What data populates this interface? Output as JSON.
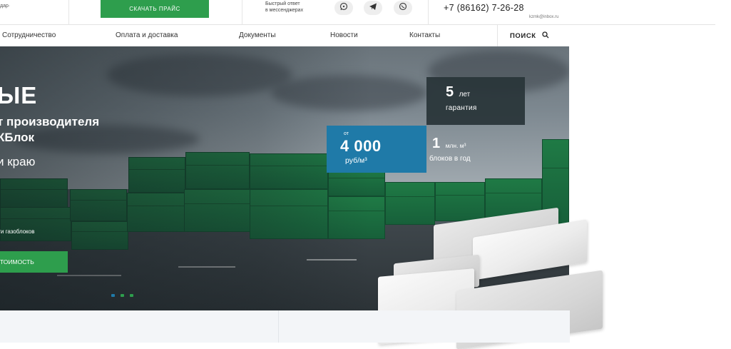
{
  "topbar": {
    "cut_text": "дар·",
    "price_button": "Скачать прайс",
    "fast_reply_line1": "Быстрый ответ",
    "fast_reply_line2": "в мессенджерах",
    "phone": "+7 (86162) 7-26-28",
    "email": "kzmk@inbox.ru"
  },
  "nav": {
    "items": [
      {
        "label": "Сотрудничество"
      },
      {
        "label": "Оплата и доставка"
      },
      {
        "label": "Документы"
      },
      {
        "label": "Новости"
      },
      {
        "label": "Контакты"
      }
    ],
    "search_label": "Поиск"
  },
  "hero": {
    "title": "ЫЕ",
    "subtitle_line1": "т производителя",
    "subtitle_line2": "КБлок",
    "subtitle_line3": "и краю",
    "note": "ги газоблоков",
    "cta_label": "тоимость",
    "slider_dots": [
      {
        "active": true
      },
      {
        "active": false
      },
      {
        "active": false
      }
    ]
  },
  "badges": {
    "warranty": {
      "number": "5",
      "unit": "лет",
      "caption": "гарантия"
    },
    "price": {
      "prefix": "от",
      "value": "4 000",
      "unit": "руб/м³"
    },
    "volume": {
      "number": "1",
      "unit": "млн. м³",
      "caption": "блоков в год"
    }
  },
  "colors": {
    "accent_green": "#2e9e4d",
    "price_blue": "#1f7aa8",
    "warranty_dark": "#2a363a"
  },
  "icons": {
    "messenger": [
      "whatsapp-icon",
      "telegram-icon",
      "viber-icon"
    ],
    "search": "search-icon"
  }
}
